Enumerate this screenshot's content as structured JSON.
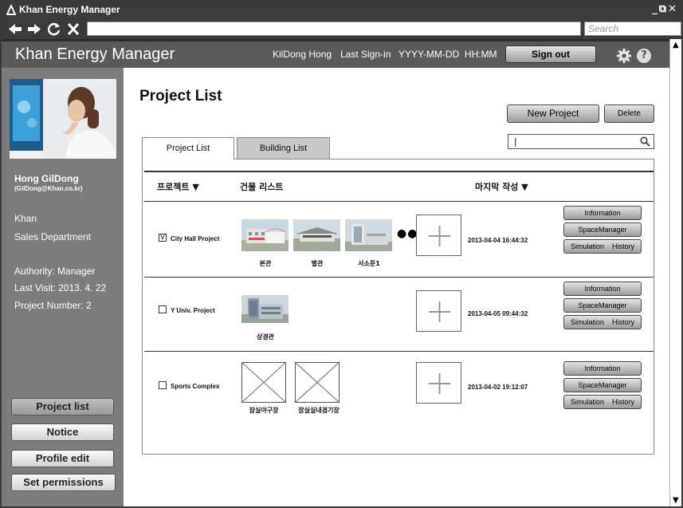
{
  "window": {
    "title": "Khan Energy Manager",
    "search_placeholder": "Search"
  },
  "header": {
    "brand": "Khan Energy Manager",
    "user_name": "KilDong Hong",
    "last_sign_in_label": "Last Sign-in",
    "datetime": "YYYY-MM-DD  HH:MM",
    "sign_out": "Sign out"
  },
  "sidebar": {
    "name": "Hong GilDong",
    "email": "(GilDong@Khan.co.kr)",
    "company": "Khan",
    "department": "Sales Department",
    "authority": "Authority: Manager",
    "last_visit": "Last Visit: 2013. 4. 22",
    "project_number": "Project Number: 2",
    "buttons": [
      "Project list",
      "Notice",
      "Profile edit",
      "Set permissions"
    ]
  },
  "main": {
    "title": "Project  List",
    "new_project": "New Project",
    "delete": "Delete",
    "search_value": "|",
    "tabs": [
      "Project List",
      "Building List"
    ],
    "columns": {
      "project": "프로젝트",
      "buildings": "건물 리스트",
      "last_modified": "마지막 작성"
    },
    "row_buttons": {
      "information": "Information",
      "space_manager": "SpaceManager",
      "simulation": "Simulation    History"
    },
    "projects": [
      {
        "name": "City Hall  Project",
        "checked": true,
        "check_mark": "V",
        "date": "2013-04-04 16:44:32",
        "buildings": [
          "본관",
          "별관",
          "서소문1"
        ],
        "more": "●●●"
      },
      {
        "name": "Y Univ. Project",
        "checked": false,
        "check_mark": "",
        "date": "2013-04-05 09:44:32",
        "buildings": [
          "상경관"
        ]
      },
      {
        "name": "Sports Complex",
        "checked": false,
        "check_mark": "",
        "date": "2013-04-02 19:12:07",
        "buildings": [
          "잠실야구장",
          "잠실실내경기장"
        ]
      }
    ]
  }
}
